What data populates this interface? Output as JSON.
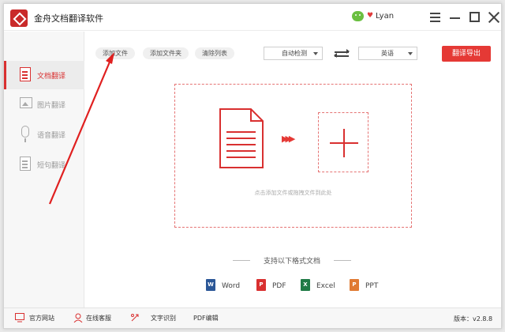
{
  "app": {
    "title": "金舟文档翻译软件",
    "user": "Lyan"
  },
  "sidebar": {
    "items": [
      {
        "label": "文档翻译",
        "active": true
      },
      {
        "label": "图片翻译",
        "active": false
      },
      {
        "label": "语音翻译",
        "active": false
      },
      {
        "label": "短句翻译",
        "active": false
      }
    ]
  },
  "toolbar": {
    "add_file": "添加文件",
    "add_folder": "添加文件夹",
    "clear_list": "清除列表",
    "source_lang": "自动检测",
    "target_lang": "英语",
    "translate_export": "翻译导出"
  },
  "dropzone": {
    "hint": "点击添加文件或拖拽文件到此处"
  },
  "formats": {
    "title": "支持以下格式文档",
    "items": [
      {
        "label": "Word",
        "icon": "word-icon",
        "color": "#2b5797"
      },
      {
        "label": "PDF",
        "icon": "pdf-icon",
        "color": "#d93030"
      },
      {
        "label": "Excel",
        "icon": "excel-icon",
        "color": "#1f7a45"
      },
      {
        "label": "PPT",
        "icon": "ppt-icon",
        "color": "#e07a32"
      }
    ]
  },
  "statusbar": {
    "official_site": "官方网站",
    "online_service": "在线客服",
    "ocr": "文字识别",
    "pdf_edit": "PDF编辑",
    "version": "版本：v2.8.8"
  },
  "colors": {
    "accent": "#e53935"
  }
}
